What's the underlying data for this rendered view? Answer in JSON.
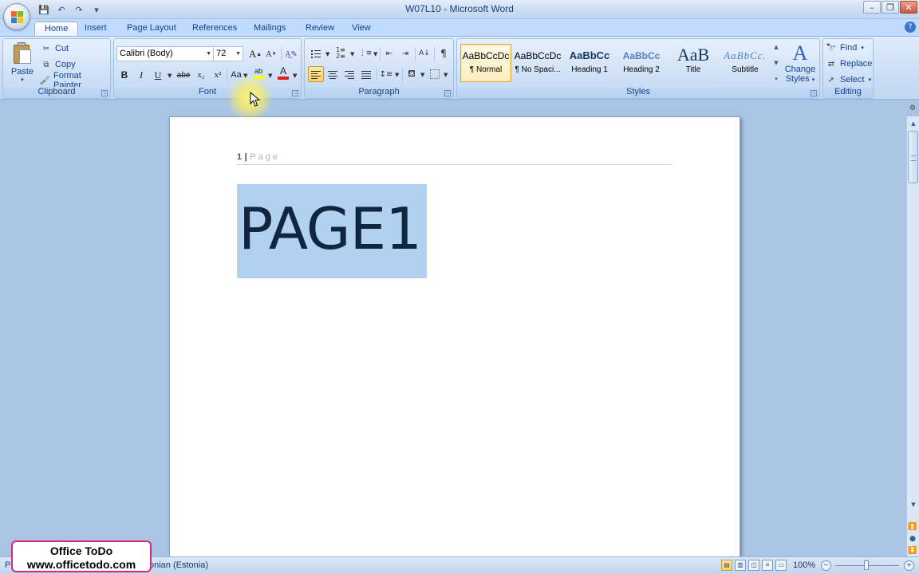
{
  "window": {
    "title": "W07L10 - Microsoft Word",
    "minimize": "–",
    "restore": "❐",
    "close": "✕"
  },
  "qat": [
    "💾",
    "↶",
    "↷",
    "▾"
  ],
  "tabs": [
    {
      "label": "Home",
      "active": true
    },
    {
      "label": "Insert"
    },
    {
      "label": "Page Layout"
    },
    {
      "label": "References"
    },
    {
      "label": "Mailings"
    },
    {
      "label": "Review"
    },
    {
      "label": "View"
    }
  ],
  "clipboard": {
    "group_label": "Clipboard",
    "paste": "Paste",
    "cut": "Cut",
    "copy": "Copy",
    "format_painter": "Format Painter"
  },
  "font": {
    "group_label": "Font",
    "font_name": "Calibri (Body)",
    "font_size": "72",
    "grow": "A",
    "shrink": "A",
    "bold": "B",
    "italic": "I",
    "underline": "U",
    "strike": "abe",
    "subscript": "x₂",
    "superscript": "x²",
    "change_case": "Aa",
    "highlight": "ab",
    "font_color": "A"
  },
  "paragraph": {
    "group_label": "Paragraph",
    "show_marks": "¶"
  },
  "styles": {
    "group_label": "Styles",
    "items": [
      {
        "sample": "AaBbCcDc",
        "name": "¶ Normal",
        "selected": true
      },
      {
        "sample": "AaBbCcDc",
        "name": "¶ No Spaci..."
      },
      {
        "sample": "AaBbCc",
        "name": "Heading 1"
      },
      {
        "sample": "AaBbCc",
        "name": "Heading 2"
      },
      {
        "sample": "AaB",
        "name": "Title"
      },
      {
        "sample": "AaBbCc.",
        "name": "Subtitle"
      }
    ],
    "change_styles_1": "Change",
    "change_styles_2": "Styles"
  },
  "editing": {
    "group_label": "Editing",
    "find": "Find",
    "replace": "Replace",
    "select": "Select"
  },
  "document": {
    "header_page_number": "1",
    "header_separator": "|",
    "header_word": "Page",
    "body_text": "PAGE1"
  },
  "status": {
    "left": "P",
    "language": "onian (Estonia)",
    "zoom": "100%"
  },
  "watermark": {
    "line1": "Office ToDo",
    "line2": "www.officetodo.com"
  },
  "colors": {
    "ribbon_bg": "#c8dcf5",
    "selection": "#b2d0ef",
    "accent_border": "#d4287a",
    "body_text": "#0f2540"
  }
}
